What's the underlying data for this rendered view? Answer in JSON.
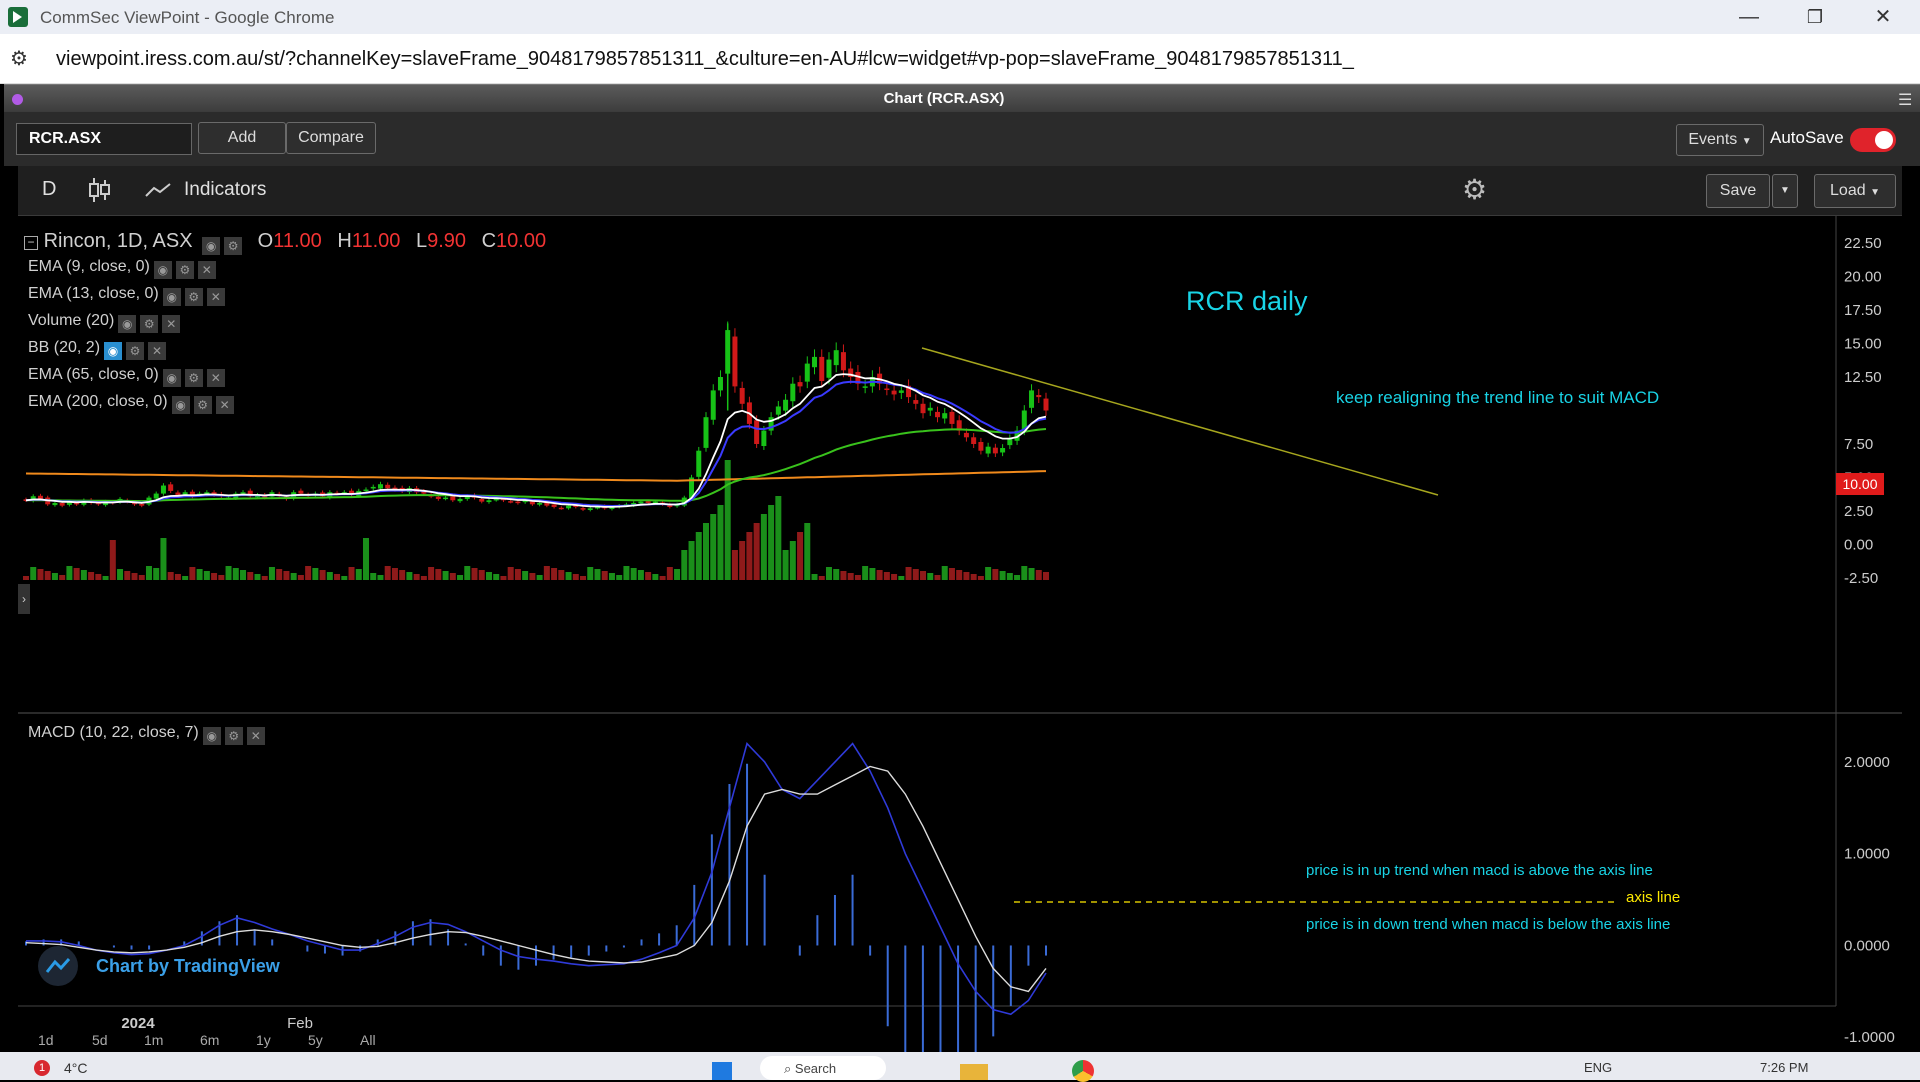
{
  "window": {
    "title": "CommSec ViewPoint - Google Chrome"
  },
  "address": {
    "url": "viewpoint.iress.com.au/st/?channelKey=slaveFrame_9048179857851311_&culture=en-AU#lcw=widget#vp-pop=slaveFrame_9048179857851311_"
  },
  "widget": {
    "title": "Chart (RCR.ASX)"
  },
  "toolbar": {
    "symbol": "RCR.ASX",
    "add_label": "Add",
    "compare_label": "Compare",
    "events_label": "Events",
    "autosave_label": "AutoSave",
    "autosave_on": true
  },
  "chart_tools": {
    "interval": "D",
    "indicators_label": "Indicators",
    "save_label": "Save",
    "load_label": "Load"
  },
  "legend": {
    "title": "Rincon, 1D, ASX",
    "o_label": "O",
    "o_value": "11.00",
    "h_label": "H",
    "h_value": "11.00",
    "l_label": "L",
    "l_value": "9.90",
    "c_label": "C",
    "c_value": "10.00",
    "studies": [
      "EMA (9, close, 0)",
      "EMA (13, close, 0)",
      "Volume (20)",
      "BB (20, 2)",
      "EMA (65, close, 0)",
      "EMA (200, close, 0)"
    ]
  },
  "annotations": {
    "main_title": "RCR daily",
    "trend_note": "keep realigning the trend line to suit MACD",
    "up_trend": "price is in up trend when macd is above the axis line",
    "axis_line": "axis line",
    "down_trend": "price is  in down trend when macd is below the axis line"
  },
  "macd": {
    "label": "MACD (10, 22, close, 7)"
  },
  "branding": {
    "label": "Chart by TradingView"
  },
  "price_axis": [
    "22.50",
    "20.00",
    "17.50",
    "15.00",
    "12.50",
    "10.00",
    "7.50",
    "5.00",
    "2.50",
    "0.00",
    "-2.50"
  ],
  "last_price": "10.00",
  "macd_axis": [
    "2.0000",
    "1.0000",
    "0.0000",
    "-1.0000"
  ],
  "time_axis": [
    "2024",
    "Feb"
  ],
  "ranges": [
    "1d",
    "5d",
    "1m",
    "6m",
    "1y",
    "5y",
    "All"
  ],
  "taskbar": {
    "weather": "4°C",
    "notif_count": "1",
    "search_label": "Search",
    "lang": "ENG",
    "time": "7:26 PM"
  },
  "colors": {
    "up": "#17c217",
    "down": "#d01919",
    "ema9": "#ffffff",
    "ema13": "#3a3aff",
    "ema65": "#39c21c",
    "ema200": "#f08a1c",
    "annotation": "#19d4e6",
    "axis_note": "#ffea00"
  },
  "chart_data": [
    {
      "type": "line",
      "title": "Rincon, 1D, ASX",
      "ylim": [
        -2.5,
        23.5
      ],
      "x": [
        0,
        1,
        2,
        3,
        4,
        5,
        6,
        7,
        8,
        9,
        10,
        11,
        12,
        13,
        14,
        15,
        16,
        17,
        18,
        19,
        20,
        21,
        22,
        23,
        24,
        25,
        26,
        27,
        28,
        29,
        30,
        31,
        32,
        33,
        34,
        35,
        36,
        37,
        38,
        39,
        40,
        41,
        42,
        43,
        44,
        45,
        46,
        47,
        48,
        49,
        50,
        51,
        52,
        53,
        54,
        55,
        56,
        57,
        58,
        59,
        60,
        61,
        62,
        63,
        64,
        65,
        66,
        67,
        68,
        69,
        70,
        71,
        72,
        73,
        74,
        75,
        76,
        77,
        78,
        79,
        80,
        81,
        82,
        83,
        84,
        85,
        86,
        87,
        88,
        89,
        90,
        91,
        92,
        93,
        94,
        95,
        96,
        97,
        98,
        99,
        100,
        101,
        102,
        103,
        104,
        105,
        106,
        107,
        108,
        109,
        110,
        111,
        112,
        113,
        114,
        115,
        116,
        117,
        118,
        119,
        120,
        121,
        122,
        123,
        124,
        125,
        126,
        127,
        128,
        129,
        130,
        131,
        132,
        133,
        134,
        135,
        136,
        137,
        138,
        139,
        140,
        141
      ],
      "series": [
        {
          "name": "C",
          "values": [
            3.3,
            3.6,
            3.4,
            3.0,
            3.1,
            2.9,
            3.2,
            3.0,
            3.3,
            3.1,
            3.0,
            3.2,
            3.1,
            3.4,
            3.2,
            3.0,
            2.9,
            3.5,
            3.8,
            4.4,
            4.0,
            3.7,
            3.9,
            3.6,
            3.8,
            3.9,
            3.7,
            3.6,
            3.5,
            3.8,
            3.9,
            3.6,
            3.7,
            3.5,
            3.9,
            3.6,
            3.4,
            3.9,
            3.8,
            3.7,
            3.8,
            3.6,
            3.9,
            3.8,
            3.9,
            3.7,
            4.0,
            4.1,
            4.3,
            4.5,
            4.2,
            4.1,
            4.0,
            4.2,
            3.9,
            3.8,
            3.6,
            3.4,
            3.5,
            3.3,
            3.4,
            3.6,
            3.5,
            3.2,
            3.3,
            3.4,
            3.3,
            3.2,
            3.1,
            3.3,
            3.0,
            3.1,
            2.9,
            2.8,
            2.7,
            2.9,
            2.8,
            2.6,
            2.7,
            2.8,
            2.7,
            2.8,
            2.9,
            3.0,
            3.1,
            3.2,
            3.1,
            3.2,
            3.0,
            2.8,
            3.0,
            3.5,
            5.0,
            7.0,
            9.5,
            11.5,
            12.5,
            16.0,
            11.8,
            10.5,
            9.0,
            7.5,
            8.5,
            9.5,
            10.3,
            10.8,
            12.0,
            11.8,
            13.5,
            14.0,
            12.2,
            13.8,
            14.5,
            13.0,
            12.5,
            12.0,
            11.8,
            12.5,
            12.0,
            11.6,
            11.2,
            11.5,
            11.0,
            10.5,
            9.8,
            10.2,
            9.5,
            9.8,
            9.0,
            8.5,
            8.0,
            7.5,
            7.0,
            7.3,
            6.8,
            7.2,
            7.9,
            8.5,
            10.0,
            11.5,
            11.0,
            10.0
          ]
        }
      ]
    },
    {
      "type": "line",
      "title": "MACD (10, 22, close, 7)",
      "ylim": [
        -1.15,
        2.25
      ],
      "series": [
        {
          "name": "MACD",
          "values": [
            0.05,
            0.05,
            0.04,
            0.0,
            -0.05,
            -0.08,
            -0.1,
            -0.09,
            -0.05,
            0.0,
            0.1,
            0.22,
            0.3,
            0.25,
            0.18,
            0.12,
            0.05,
            0.0,
            -0.05,
            -0.05,
            0.02,
            0.1,
            0.2,
            0.25,
            0.23,
            0.15,
            0.05,
            -0.05,
            -0.12,
            -0.15,
            -0.17,
            -0.2,
            -0.22,
            -0.21,
            -0.2,
            -0.15,
            -0.08,
            0.0,
            0.3,
            0.8,
            1.5,
            2.2,
            2.0,
            1.7,
            1.6,
            1.8,
            2.0,
            2.2,
            1.9,
            1.5,
            1.0,
            0.6,
            0.2,
            -0.2,
            -0.5,
            -0.7,
            -0.75,
            -0.6,
            -0.3
          ]
        },
        {
          "name": "Signal",
          "values": [
            0.03,
            0.02,
            0.01,
            -0.02,
            -0.05,
            -0.07,
            -0.08,
            -0.07,
            -0.05,
            -0.02,
            0.03,
            0.1,
            0.15,
            0.17,
            0.15,
            0.12,
            0.08,
            0.04,
            0.0,
            -0.02,
            -0.01,
            0.03,
            0.08,
            0.12,
            0.15,
            0.14,
            0.1,
            0.05,
            0.0,
            -0.05,
            -0.1,
            -0.14,
            -0.17,
            -0.18,
            -0.19,
            -0.18,
            -0.14,
            -0.1,
            0.0,
            0.25,
            0.7,
            1.3,
            1.65,
            1.7,
            1.65,
            1.65,
            1.75,
            1.85,
            1.95,
            1.9,
            1.65,
            1.3,
            0.9,
            0.5,
            0.1,
            -0.25,
            -0.45,
            -0.5,
            -0.25
          ]
        }
      ]
    }
  ]
}
